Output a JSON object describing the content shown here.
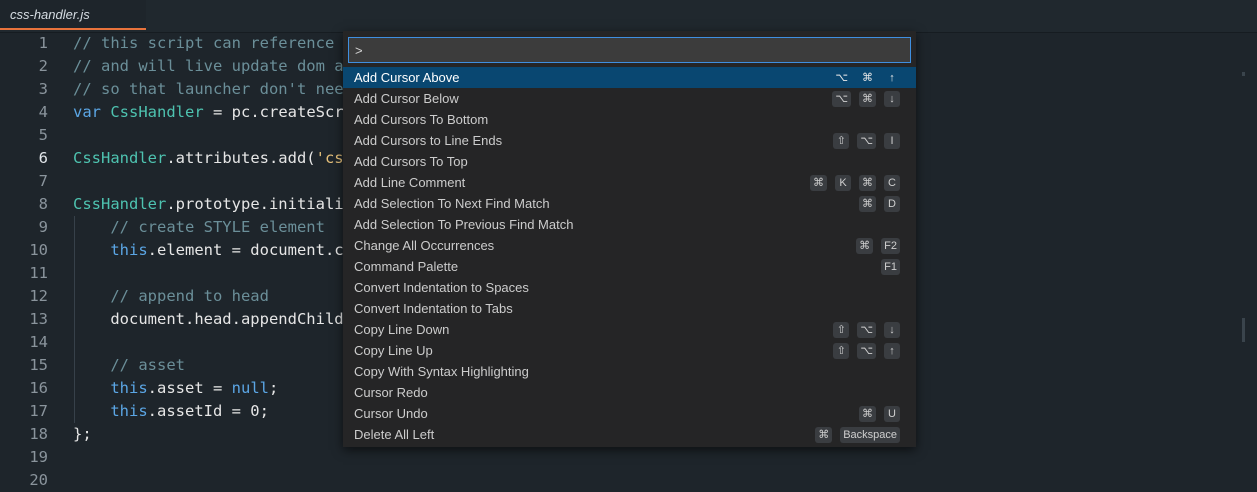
{
  "tab": {
    "title": "css-handler.js"
  },
  "editor": {
    "active_line": 6,
    "lines": [
      {
        "n": "1",
        "tokens": [
          {
            "t": "// this script can reference l",
            "c": "com"
          }
        ]
      },
      {
        "n": "2",
        "tokens": [
          {
            "t": "// and will live update dom an",
            "c": "com"
          }
        ]
      },
      {
        "n": "3",
        "tokens": [
          {
            "t": "// so that launcher don't need",
            "c": "com"
          }
        ]
      },
      {
        "n": "4",
        "tokens": [
          {
            "t": "var",
            "c": "kw"
          },
          {
            "t": " "
          },
          {
            "t": "CssHandler",
            "c": "cls"
          },
          {
            "t": " = pc.createScri"
          }
        ]
      },
      {
        "n": "5",
        "tokens": []
      },
      {
        "n": "6",
        "tokens": [
          {
            "t": "CssHandler",
            "c": "cls"
          },
          {
            "t": ".attributes.add("
          },
          {
            "t": "'css",
            "c": "str"
          }
        ]
      },
      {
        "n": "7",
        "tokens": []
      },
      {
        "n": "8",
        "tokens": [
          {
            "t": "CssHandler",
            "c": "cls"
          },
          {
            "t": ".prototype.initializ"
          }
        ]
      },
      {
        "n": "9",
        "tokens": [
          {
            "t": "    "
          },
          {
            "t": "// create STYLE element",
            "c": "com"
          }
        ]
      },
      {
        "n": "10",
        "tokens": [
          {
            "t": "    "
          },
          {
            "t": "this",
            "c": "kw"
          },
          {
            "t": ".element = document.cr"
          }
        ]
      },
      {
        "n": "11",
        "tokens": []
      },
      {
        "n": "12",
        "tokens": [
          {
            "t": "    "
          },
          {
            "t": "// append to head",
            "c": "com"
          }
        ]
      },
      {
        "n": "13",
        "tokens": [
          {
            "t": "    document.head.appendChild("
          }
        ]
      },
      {
        "n": "14",
        "tokens": []
      },
      {
        "n": "15",
        "tokens": [
          {
            "t": "    "
          },
          {
            "t": "// asset",
            "c": "com"
          }
        ]
      },
      {
        "n": "16",
        "tokens": [
          {
            "t": "    "
          },
          {
            "t": "this",
            "c": "kw"
          },
          {
            "t": ".asset = "
          },
          {
            "t": "null",
            "c": "kw"
          },
          {
            "t": ";"
          }
        ]
      },
      {
        "n": "17",
        "tokens": [
          {
            "t": "    "
          },
          {
            "t": "this",
            "c": "kw"
          },
          {
            "t": ".assetId = 0;"
          }
        ]
      },
      {
        "n": "18",
        "tokens": [
          {
            "t": "};"
          }
        ]
      },
      {
        "n": "19",
        "tokens": []
      },
      {
        "n": "20",
        "tokens": []
      }
    ]
  },
  "palette": {
    "input_value": ">",
    "items": [
      {
        "label": "Add Cursor Above",
        "keys": [
          "⌥",
          "⌘",
          "↑"
        ],
        "selected": true
      },
      {
        "label": "Add Cursor Below",
        "keys": [
          "⌥",
          "⌘",
          "↓"
        ]
      },
      {
        "label": "Add Cursors To Bottom",
        "keys": []
      },
      {
        "label": "Add Cursors to Line Ends",
        "keys": [
          "⇧",
          "⌥",
          "I"
        ]
      },
      {
        "label": "Add Cursors To Top",
        "keys": []
      },
      {
        "label": "Add Line Comment",
        "keys": [
          "⌘",
          "K",
          "⌘",
          "C"
        ]
      },
      {
        "label": "Add Selection To Next Find Match",
        "keys": [
          "⌘",
          "D"
        ]
      },
      {
        "label": "Add Selection To Previous Find Match",
        "keys": []
      },
      {
        "label": "Change All Occurrences",
        "keys": [
          "⌘",
          "F2"
        ]
      },
      {
        "label": "Command Palette",
        "keys": [
          "F1"
        ]
      },
      {
        "label": "Convert Indentation to Spaces",
        "keys": []
      },
      {
        "label": "Convert Indentation to Tabs",
        "keys": []
      },
      {
        "label": "Copy Line Down",
        "keys": [
          "⇧",
          "⌥",
          "↓"
        ]
      },
      {
        "label": "Copy Line Up",
        "keys": [
          "⇧",
          "⌥",
          "↑"
        ]
      },
      {
        "label": "Copy With Syntax Highlighting",
        "keys": []
      },
      {
        "label": "Cursor Redo",
        "keys": []
      },
      {
        "label": "Cursor Undo",
        "keys": [
          "⌘",
          "U"
        ]
      },
      {
        "label": "Delete All Left",
        "keys": [
          "⌘",
          "Backspace"
        ]
      }
    ]
  }
}
